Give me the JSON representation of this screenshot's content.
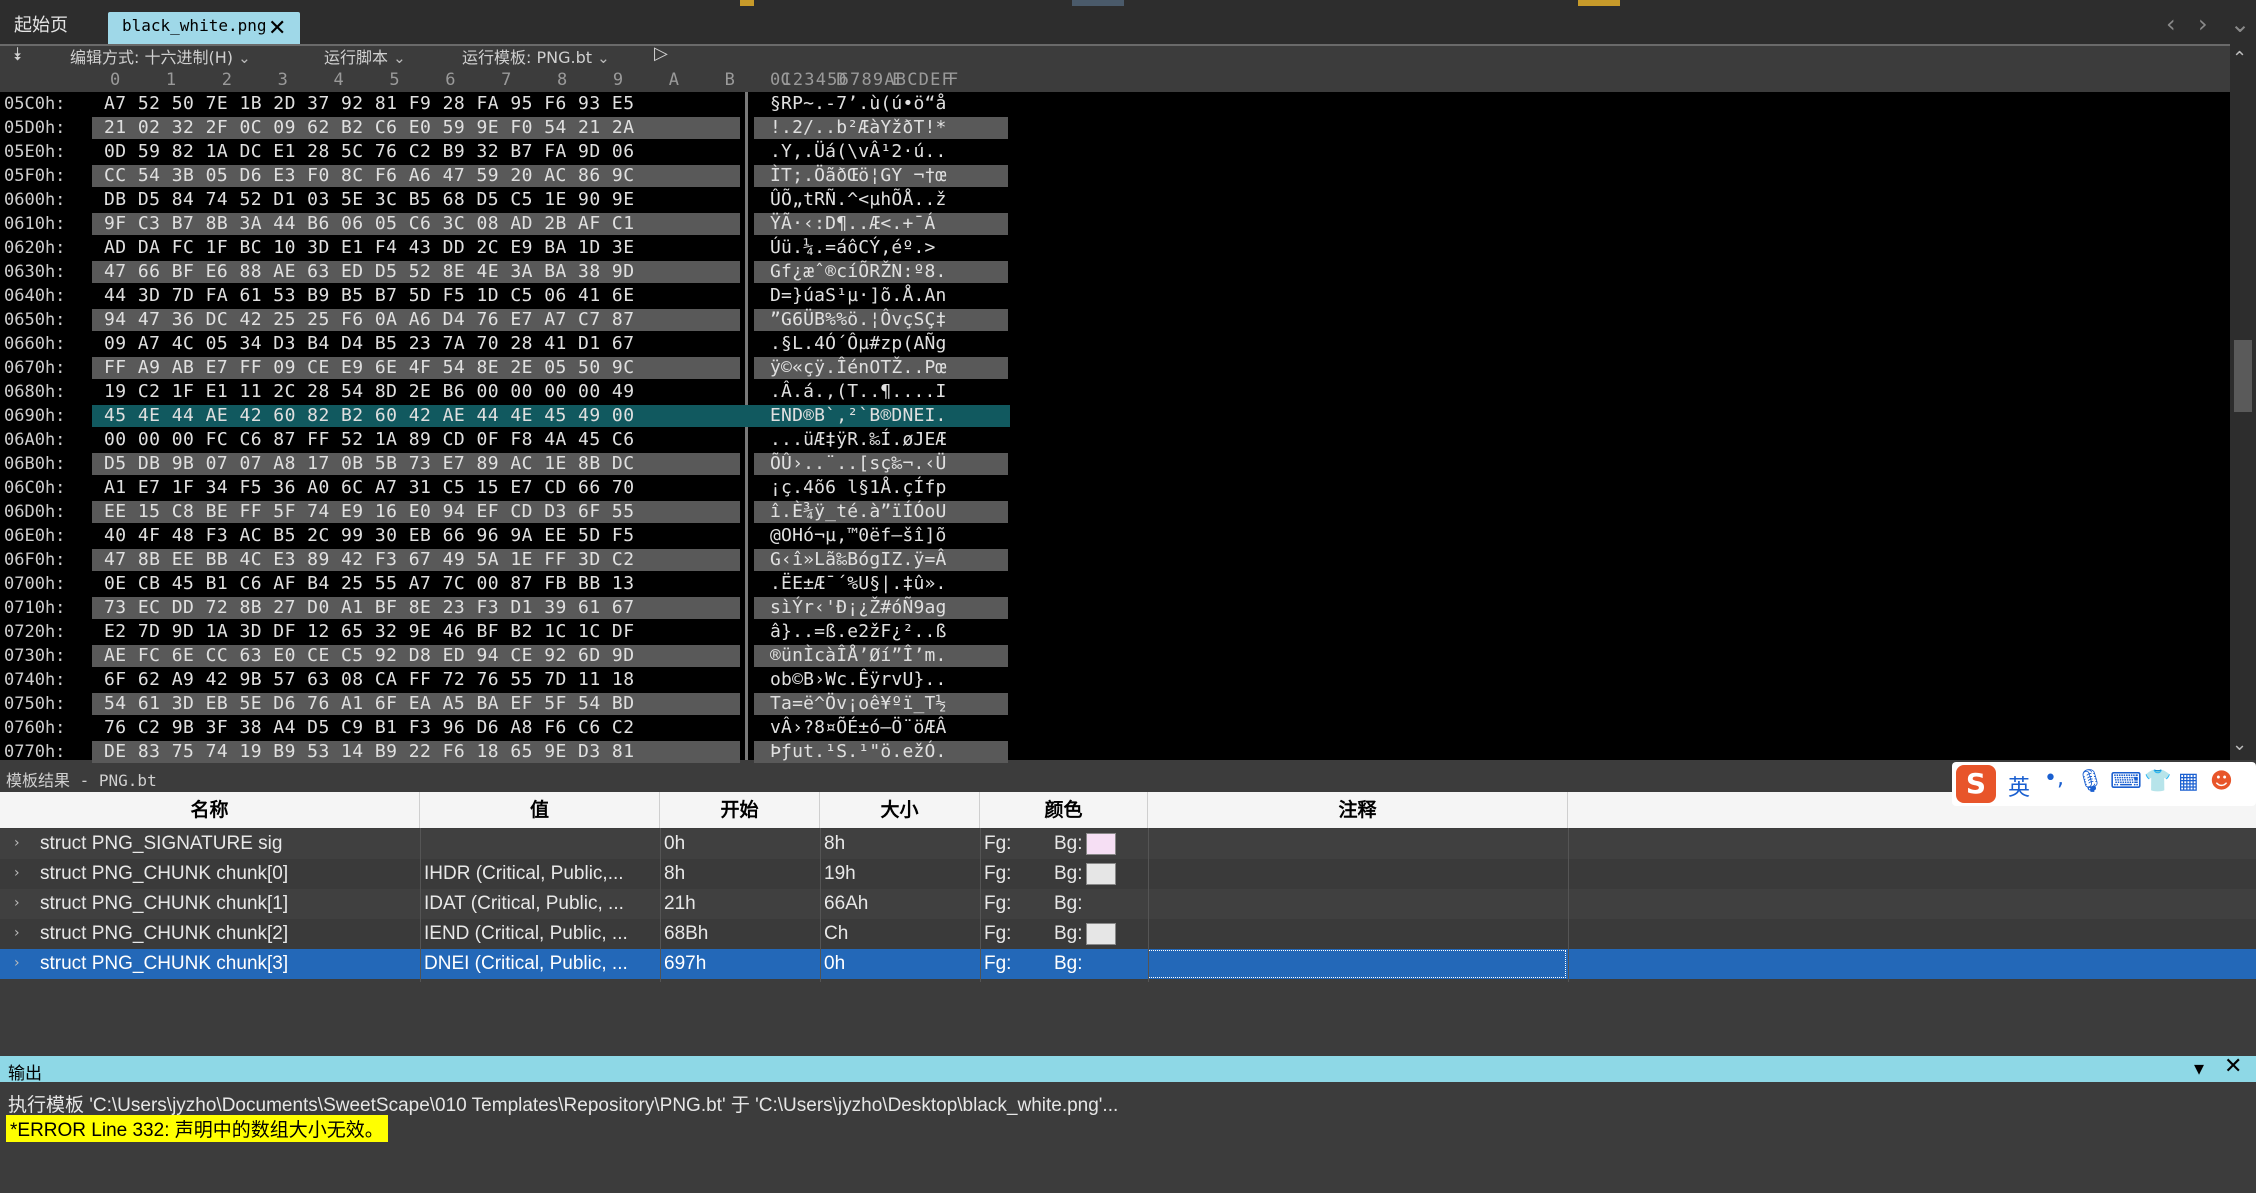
{
  "tabs": {
    "start_label": "起始页",
    "file_label": "black_white.png",
    "close_glyph": "✕"
  },
  "toolbar": {
    "edit_mode": "编辑方式: 十六进制(H)",
    "run_script": "运行脚本",
    "run_template": "运行模板: PNG.bt"
  },
  "hex": {
    "col_header": "0 1 2 3 4 5 6 7 8 9 A B C D E F",
    "ascii_header": "0123456789ABCDEF",
    "rows": [
      {
        "addr": "05C0h:",
        "hex": "A7 52 50 7E 1B 2D 37 92 81 F9 28 FA 95 F6 93 E5",
        "ascii": "§RP~.-7’.ù(ú•ö“å"
      },
      {
        "addr": "05D0h:",
        "hex": "21 02 32 2F 0C 09 62 B2 C6 E0 59 9E F0 54 21 2A",
        "ascii": "!.2/..b²ÆàYžðT!*"
      },
      {
        "addr": "05E0h:",
        "hex": "0D 59 82 1A DC E1 28 5C 76 C2 B9 32 B7 FA 9D 06",
        "ascii": ".Y,.Üá(\\vÂ¹2·ú.."
      },
      {
        "addr": "05F0h:",
        "hex": "CC 54 3B 05 D6 E3 F0 8C F6 A6 47 59 20 AC 86 9C",
        "ascii": "ÌT;.ÖãðŒö¦GY ¬†œ"
      },
      {
        "addr": "0600h:",
        "hex": "DB D5 84 74 52 D1 03 5E 3C B5 68 D5 C5 1E 90 9E",
        "ascii": "ÛÕ„tRÑ.^<µhÕÅ..ž"
      },
      {
        "addr": "0610h:",
        "hex": "9F C3 B7 8B 3A 44 B6 06 05 C6 3C 08 AD 2B AF C1",
        "ascii": "ŸÃ·‹:D¶..Æ<.­+¯Á"
      },
      {
        "addr": "0620h:",
        "hex": "AD DA FC 1F BC 10 3D E1 F4 43 DD 2C E9 BA 1D 3E",
        "ascii": "­Úü.¼.=áôCÝ,éº.>"
      },
      {
        "addr": "0630h:",
        "hex": "47 66 BF E6 88 AE 63 ED D5 52 8E 4E 3A BA 38 9D",
        "ascii": "Gf¿æˆ®cíÕRŽN:º8."
      },
      {
        "addr": "0640h:",
        "hex": "44 3D 7D FA 61 53 B9 B5 B7 5D F5 1D C5 06 41 6E",
        "ascii": "D=}úaS¹µ·]õ.Å.An"
      },
      {
        "addr": "0650h:",
        "hex": "94 47 36 DC 42 25 25 F6 0A A6 D4 76 E7 A7 C7 87",
        "ascii": "”G6ÜB%%ö.¦ÔvçSÇ‡"
      },
      {
        "addr": "0660h:",
        "hex": "09 A7 4C 05 34 D3 B4 D4 B5 23 7A 70 28 41 D1 67",
        "ascii": ".§L.4Ó´Ôµ#zp(AÑg"
      },
      {
        "addr": "0670h:",
        "hex": "FF A9 AB E7 FF 09 CE E9 6E 4F 54 8E 2E 05 50 9C",
        "ascii": "ÿ©«çÿ.ÎénOTŽ..Pœ"
      },
      {
        "addr": "0680h:",
        "hex": "19 C2 1F E1 11 2C 28 54 8D 2E B6 00 00 00 00 49",
        "ascii": ".Â.á.,(T..¶....I"
      },
      {
        "addr": "0690h:",
        "hex": "45 4E 44 AE 42 60 82 B2 60 42 AE 44 4E 45 49 00",
        "ascii": "END®B`‚²`B®DNEI."
      },
      {
        "addr": "06A0h:",
        "hex": "00 00 00 FC C6 87 FF 52 1A 89 CD 0F F8 4A 45 C6",
        "ascii": "...üÆ‡ÿR.‰Í.øJEÆ"
      },
      {
        "addr": "06B0h:",
        "hex": "D5 DB 9B 07 07 A8 17 0B 5B 73 E7 89 AC 1E 8B DC",
        "ascii": "ÕÛ›..¨..[sç‰¬.‹Ü"
      },
      {
        "addr": "06C0h:",
        "hex": "A1 E7 1F 34 F5 36 A0 6C A7 31 C5 15 E7 CD 66 70",
        "ascii": "¡ç.4õ6 l§1Å.çÍfp"
      },
      {
        "addr": "06D0h:",
        "hex": "EE 15 C8 BE FF 5F 74 E9 16 E0 94 EF CD D3 6F 55",
        "ascii": "î.È¾ÿ_té.à”ïÍÓoU"
      },
      {
        "addr": "06E0h:",
        "hex": "40 4F 48 F3 AC B5 2C 99 30 EB 66 96 9A EE 5D F5",
        "ascii": "@OHó¬µ,™0ëf–šî]õ"
      },
      {
        "addr": "06F0h:",
        "hex": "47 8B EE BB 4C E3 89 42 F3 67 49 5A 1E FF 3D C2",
        "ascii": "G‹î»Lã‰BógIZ.ÿ=Â"
      },
      {
        "addr": "0700h:",
        "hex": "0E CB 45 B1 C6 AF B4 25 55 A7 7C 00 87 FB BB 13",
        "ascii": ".ËE±Æ¯´%U§|.‡û»."
      },
      {
        "addr": "0710h:",
        "hex": "73 EC DD 72 8B 27 D0 A1 BF 8E 23 F3 D1 39 61 67",
        "ascii": "sìÝr‹'Ð¡¿Ž#óÑ9ag"
      },
      {
        "addr": "0720h:",
        "hex": "E2 7D 9D 1A 3D DF 12 65 32 9E 46 BF B2 1C 1C DF",
        "ascii": "â}..=ß.e2žF¿²..ß"
      },
      {
        "addr": "0730h:",
        "hex": "AE FC 6E CC 63 E0 CE C5 92 D8 ED 94 CE 92 6D 9D",
        "ascii": "®ünÌcàÎÅ’Øí”Î’m."
      },
      {
        "addr": "0740h:",
        "hex": "6F 62 A9 42 9B 57 63 08 CA FF 72 76 55 7D 11 18",
        "ascii": "ob©B›Wc.ÊÿrvU}.."
      },
      {
        "addr": "0750h:",
        "hex": "54 61 3D EB 5E D6 76 A1 6F EA A5 BA EF 5F 54 BD",
        "ascii": "Ta=ë^Öv¡oê¥ºï_T½"
      },
      {
        "addr": "0760h:",
        "hex": "76 C2 9B 3F 38 A4 D5 C9 B1 F3 96 D6 A8 F6 C6 C2",
        "ascii": "vÂ›?8¤ÕÉ±ó–Ö¨öÆÂ"
      },
      {
        "addr": "0770h:",
        "hex": "DE 83 75 74 19 B9 53 14 B9 22 F6 18 65 9E D3 81",
        "ascii": "Þƒut.¹S.¹\"ö.ežÓ."
      }
    ]
  },
  "template": {
    "title": "模板结果 - PNG.bt",
    "headers": [
      "名称",
      "值",
      "开始",
      "大小",
      "颜色",
      "注释"
    ],
    "rows": [
      {
        "name": "struct PNG_SIGNATURE sig",
        "value": "",
        "start": "0h",
        "size": "8h",
        "fg": "Fg:",
        "bg": "Bg:",
        "bg_color": "#f6dff4"
      },
      {
        "name": "struct PNG_CHUNK chunk[0]",
        "value": "IHDR  (Critical, Public,...",
        "start": "8h",
        "size": "19h",
        "fg": "Fg:",
        "bg": "Bg:",
        "bg_color": "#e6e6e6"
      },
      {
        "name": "struct PNG_CHUNK chunk[1]",
        "value": "IDAT  (Critical, Public, ...",
        "start": "21h",
        "size": "66Ah",
        "fg": "Fg:",
        "bg": "Bg:",
        "bg_color": ""
      },
      {
        "name": "struct PNG_CHUNK chunk[2]",
        "value": "IEND  (Critical, Public, ...",
        "start": "68Bh",
        "size": "Ch",
        "fg": "Fg:",
        "bg": "Bg:",
        "bg_color": "#e6e6e6"
      },
      {
        "name": "struct PNG_CHUNK chunk[3]",
        "value": "DNEI  (Critical, Public, ...",
        "start": "697h",
        "size": "0h",
        "fg": "Fg:",
        "bg": "Bg:",
        "bg_color": ""
      }
    ]
  },
  "ime": {
    "lang": "英"
  },
  "output": {
    "title": "输出",
    "line1": "执行模板 'C:\\Users\\jyzho\\Documents\\SweetScape\\010 Templates\\Repository\\PNG.bt' 于 'C:\\Users\\jyzho\\Desktop\\black_white.png'...",
    "line2": "*ERROR Line 332: 声明中的数组大小无效。"
  },
  "colors": {
    "accent": "#9fd8e8",
    "selection": "#2368b8",
    "highlight_row": "#11595f",
    "error_bg": "#ffff00"
  }
}
